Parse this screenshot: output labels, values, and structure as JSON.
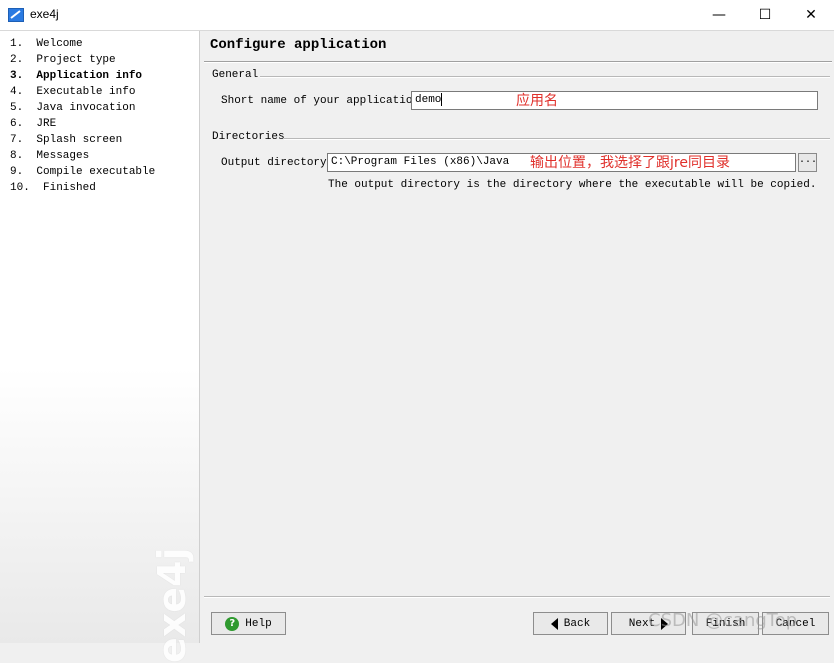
{
  "window": {
    "title": "exe4j",
    "minimize_glyph": "—",
    "maximize_glyph": "☐",
    "close_glyph": "✕"
  },
  "steps": [
    {
      "label": "1.  Welcome"
    },
    {
      "label": "2.  Project type"
    },
    {
      "label": "3.  Application info",
      "active": true
    },
    {
      "label": "4.  Executable info"
    },
    {
      "label": "5.  Java invocation"
    },
    {
      "label": "6.  JRE"
    },
    {
      "label": "7.  Splash screen"
    },
    {
      "label": "8.  Messages"
    },
    {
      "label": "9.  Compile executable"
    },
    {
      "label": "10.  Finished"
    }
  ],
  "sidebar_logo": "exe4j",
  "page": {
    "title": "Configure application",
    "general": {
      "section_label": "General",
      "short_name_label": "Short name of your application:",
      "short_name_value": "demo",
      "annotation": "应用名"
    },
    "directories": {
      "section_label": "Directories",
      "output_label": "Output directory:",
      "output_value": "C:\\Program Files (x86)\\Java",
      "browse_label": "...",
      "annotation": "输出位置，我选择了跟jre同目录",
      "hint": "The output directory is the directory where the executable will be copied."
    }
  },
  "buttons": {
    "help": "Help",
    "help_icon": "?",
    "back": "Back",
    "next": "Next",
    "finish": "Finish",
    "cancel": "Cancel"
  },
  "watermark": "CSDN @cangTop",
  "colors": {
    "annotation": "#e0302b",
    "help_icon": "#2f9a2f"
  }
}
